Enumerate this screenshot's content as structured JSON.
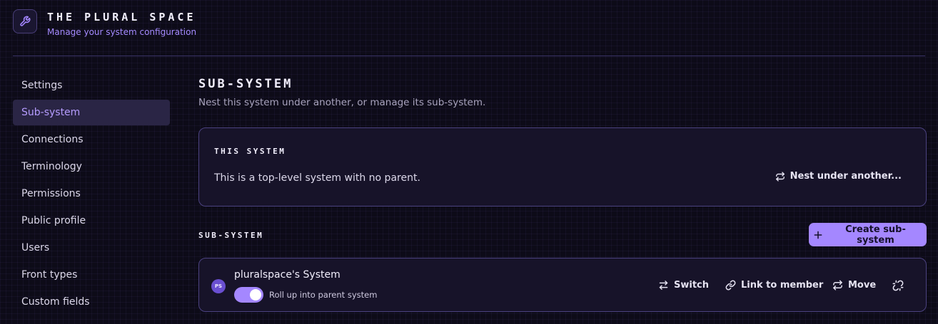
{
  "header": {
    "logo_icon": "wrench-icon",
    "title": "The Plural Space",
    "subtitle": "Manage your system configuration"
  },
  "sidebar": {
    "items": [
      {
        "label": "Settings",
        "active": false
      },
      {
        "label": "Sub-system",
        "active": true
      },
      {
        "label": "Connections",
        "active": false
      },
      {
        "label": "Terminology",
        "active": false
      },
      {
        "label": "Permissions",
        "active": false
      },
      {
        "label": "Public profile",
        "active": false
      },
      {
        "label": "Users",
        "active": false
      },
      {
        "label": "Front types",
        "active": false
      },
      {
        "label": "Custom fields",
        "active": false
      }
    ]
  },
  "main": {
    "title": "Sub-system",
    "description": "Nest this system under another, or manage its sub-system.",
    "this_system": {
      "heading": "This system",
      "text": "This is a top-level system with no parent.",
      "nest_button": "Nest under another..."
    },
    "subsystems": {
      "heading": "Sub-system",
      "create_button": "Create sub-system",
      "items": [
        {
          "avatar": "PS",
          "name": "pluralspace's System",
          "rollup_label": "Roll up into parent system",
          "rollup_on": true,
          "actions": {
            "switch": "Switch",
            "link": "Link to member",
            "move": "Move"
          }
        }
      ]
    }
  },
  "colors": {
    "accent": "#a487ff",
    "background": "#0d0b18",
    "card": "#171329",
    "border": "#4b4280"
  }
}
